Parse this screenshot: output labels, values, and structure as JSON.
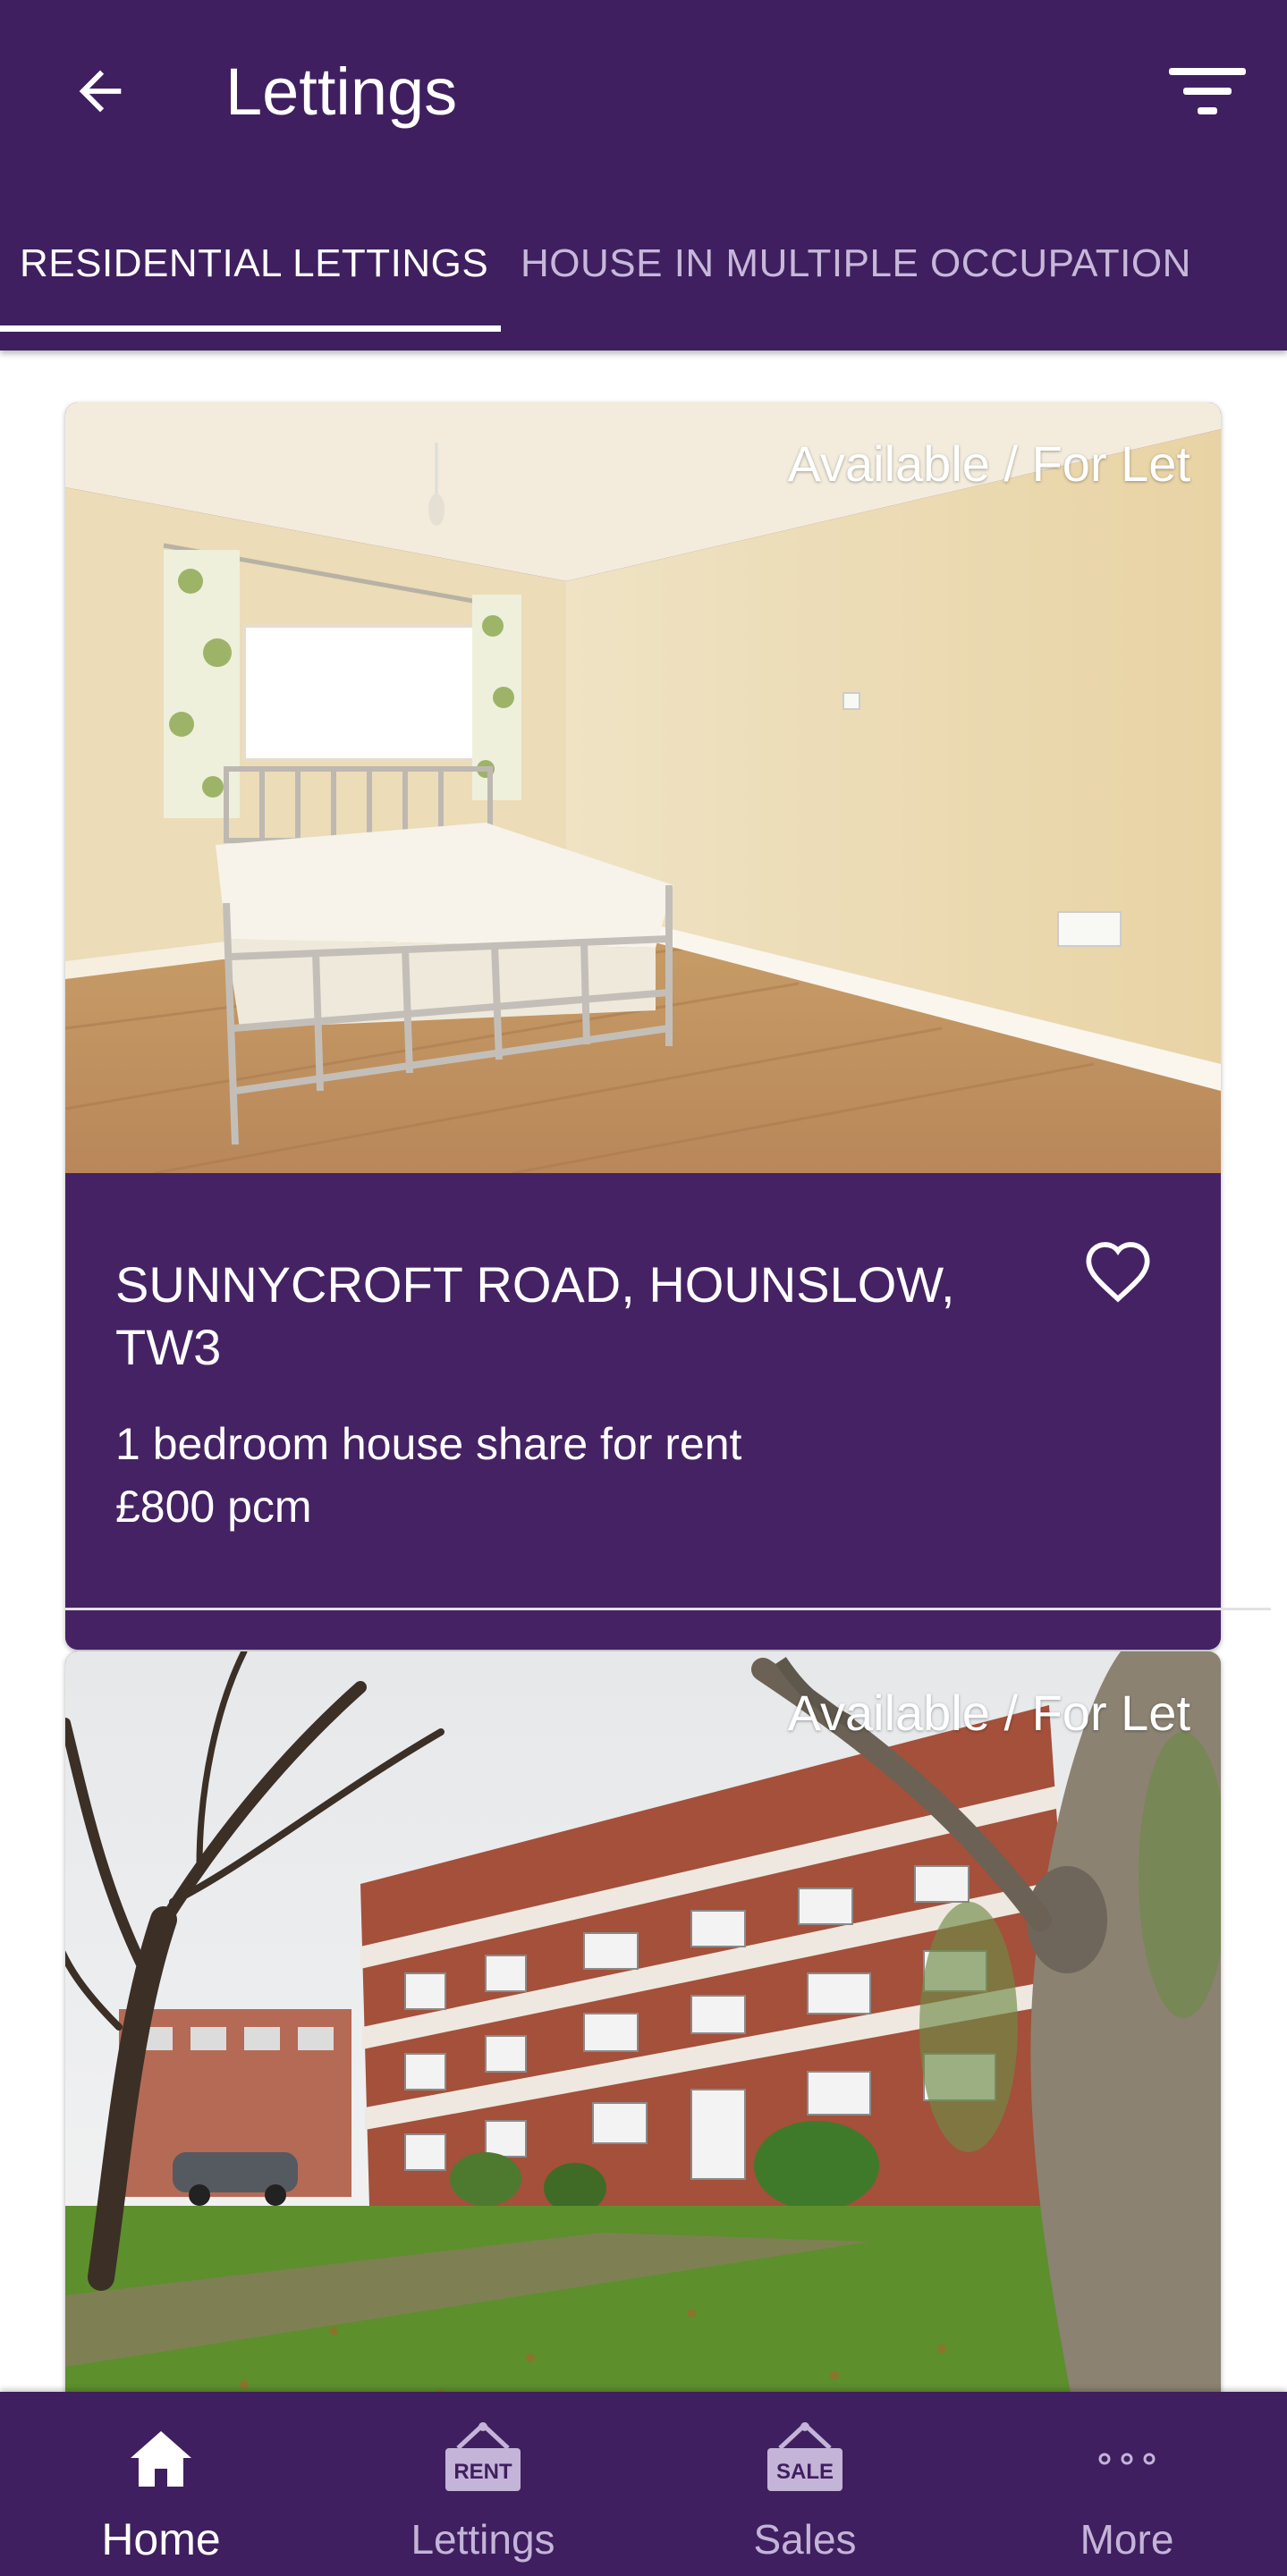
{
  "appbar": {
    "title": "Lettings",
    "back_icon": "arrow-left-icon",
    "filter_icon": "filter-icon"
  },
  "tabs": [
    {
      "label": "RESIDENTIAL LETTINGS",
      "active": true
    },
    {
      "label": "HOUSE IN MULTIPLE OCCUPATION",
      "active": false
    }
  ],
  "listings": [
    {
      "status": "Available / For Let",
      "address": "SUNNYCROFT ROAD, HOUNSLOW, TW3",
      "description": "1 bedroom house share for rent",
      "price": "£800 pcm",
      "favorite_icon": "heart-outline-icon"
    },
    {
      "status": "Available / For Let"
    }
  ],
  "bottom_nav": [
    {
      "label": "Home",
      "icon": "home-icon",
      "active": true
    },
    {
      "label": "Lettings",
      "icon": "rent-sign-icon",
      "icon_text": "RENT",
      "active": false
    },
    {
      "label": "Sales",
      "icon": "sale-sign-icon",
      "icon_text": "SALE",
      "active": false
    },
    {
      "label": "More",
      "icon": "more-dots-icon",
      "active": false
    }
  ],
  "colors": {
    "primary": "#3f1f5f",
    "card": "#452264",
    "inactive_text": "#c7b8da"
  }
}
